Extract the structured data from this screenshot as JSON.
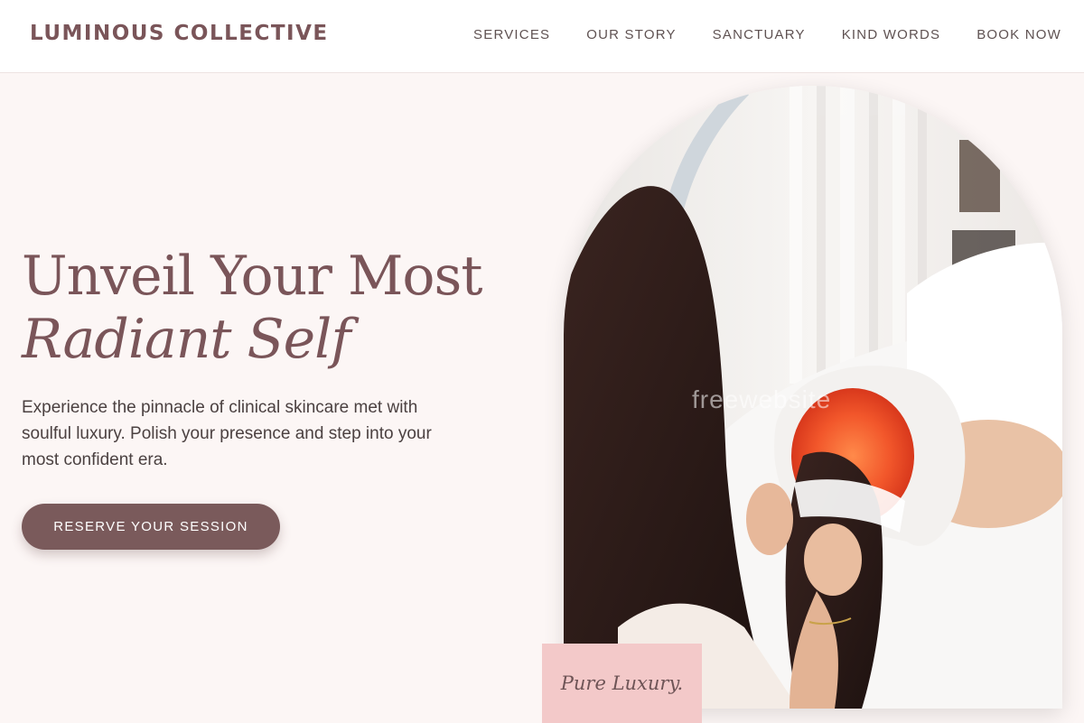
{
  "brand": {
    "name": "LUMINOUS COLLECTIVE"
  },
  "nav": {
    "items": [
      {
        "label": "SERVICES"
      },
      {
        "label": "OUR STORY"
      },
      {
        "label": "SANCTUARY"
      },
      {
        "label": "KIND WORDS"
      },
      {
        "label": "BOOK NOW"
      }
    ]
  },
  "hero": {
    "headline_line1": "Unveil Your Most",
    "headline_line2": "Radiant Self",
    "description": "Experience the pinnacle of clinical skincare met with soulful luxury. Polish your presence and step into your most confident era.",
    "cta_label": "RESERVE YOUR SESSION",
    "image_watermark": "freewebsite",
    "badge_label": "Pure Luxury."
  },
  "colors": {
    "brand": "#7a5559",
    "cta": "#7a5a5b",
    "page_background": "#fcf6f5",
    "badge_background": "#f3c9c9"
  }
}
